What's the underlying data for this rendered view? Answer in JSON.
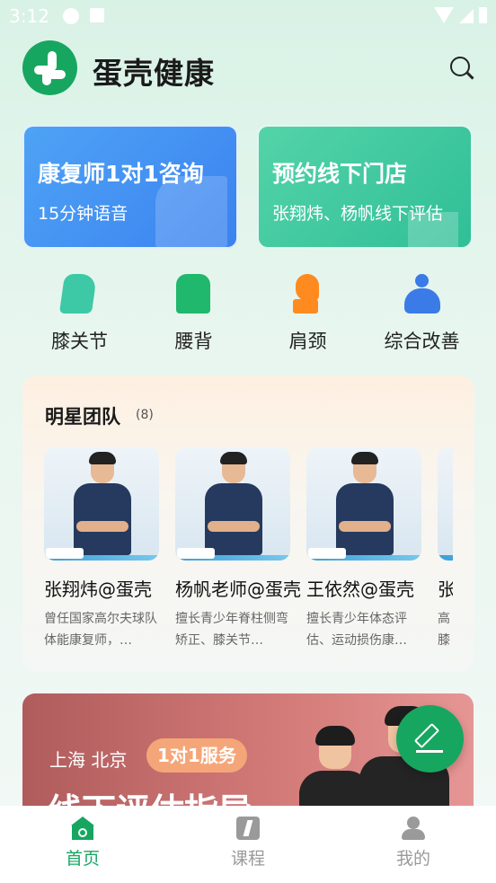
{
  "status_bar": {
    "time": "3:12"
  },
  "header": {
    "app_title": "蛋壳健康"
  },
  "service_cards": [
    {
      "title": "康复师1对1咨询",
      "subtitle": "15分钟语音",
      "color": "#3b82f0"
    },
    {
      "title": "预约线下门店",
      "subtitle": "张翔炜、杨帆线下评估",
      "color": "#30bf97"
    }
  ],
  "categories": [
    {
      "label": "膝关节",
      "icon": "knee-icon"
    },
    {
      "label": "腰背",
      "icon": "back-icon"
    },
    {
      "label": "肩颈",
      "icon": "neck-icon"
    },
    {
      "label": "综合改善",
      "icon": "yoga-icon"
    }
  ],
  "team": {
    "title": "明星团队",
    "count": "(8)",
    "members": [
      {
        "name": "张翔炜@蛋壳",
        "desc": "曾任国家高尔夫球队体能康复师，…"
      },
      {
        "name": "杨帆老师@蛋壳",
        "desc": "擅长青少年脊柱侧弯矫正、膝关节…"
      },
      {
        "name": "王依然@蛋壳",
        "desc": "擅长青少年体态评估、运动损伤康…"
      },
      {
        "name": "张",
        "desc": "高膝"
      }
    ]
  },
  "banner": {
    "cities": "上海 北京",
    "pill": "1对1服务",
    "title": "线下评估指导"
  },
  "tabbar": {
    "items": [
      {
        "label": "首页",
        "active": true
      },
      {
        "label": "课程",
        "active": false
      },
      {
        "label": "我的",
        "active": false
      }
    ]
  },
  "colors": {
    "brand_green": "#17a660",
    "inactive_gray": "#9a9a9a"
  }
}
